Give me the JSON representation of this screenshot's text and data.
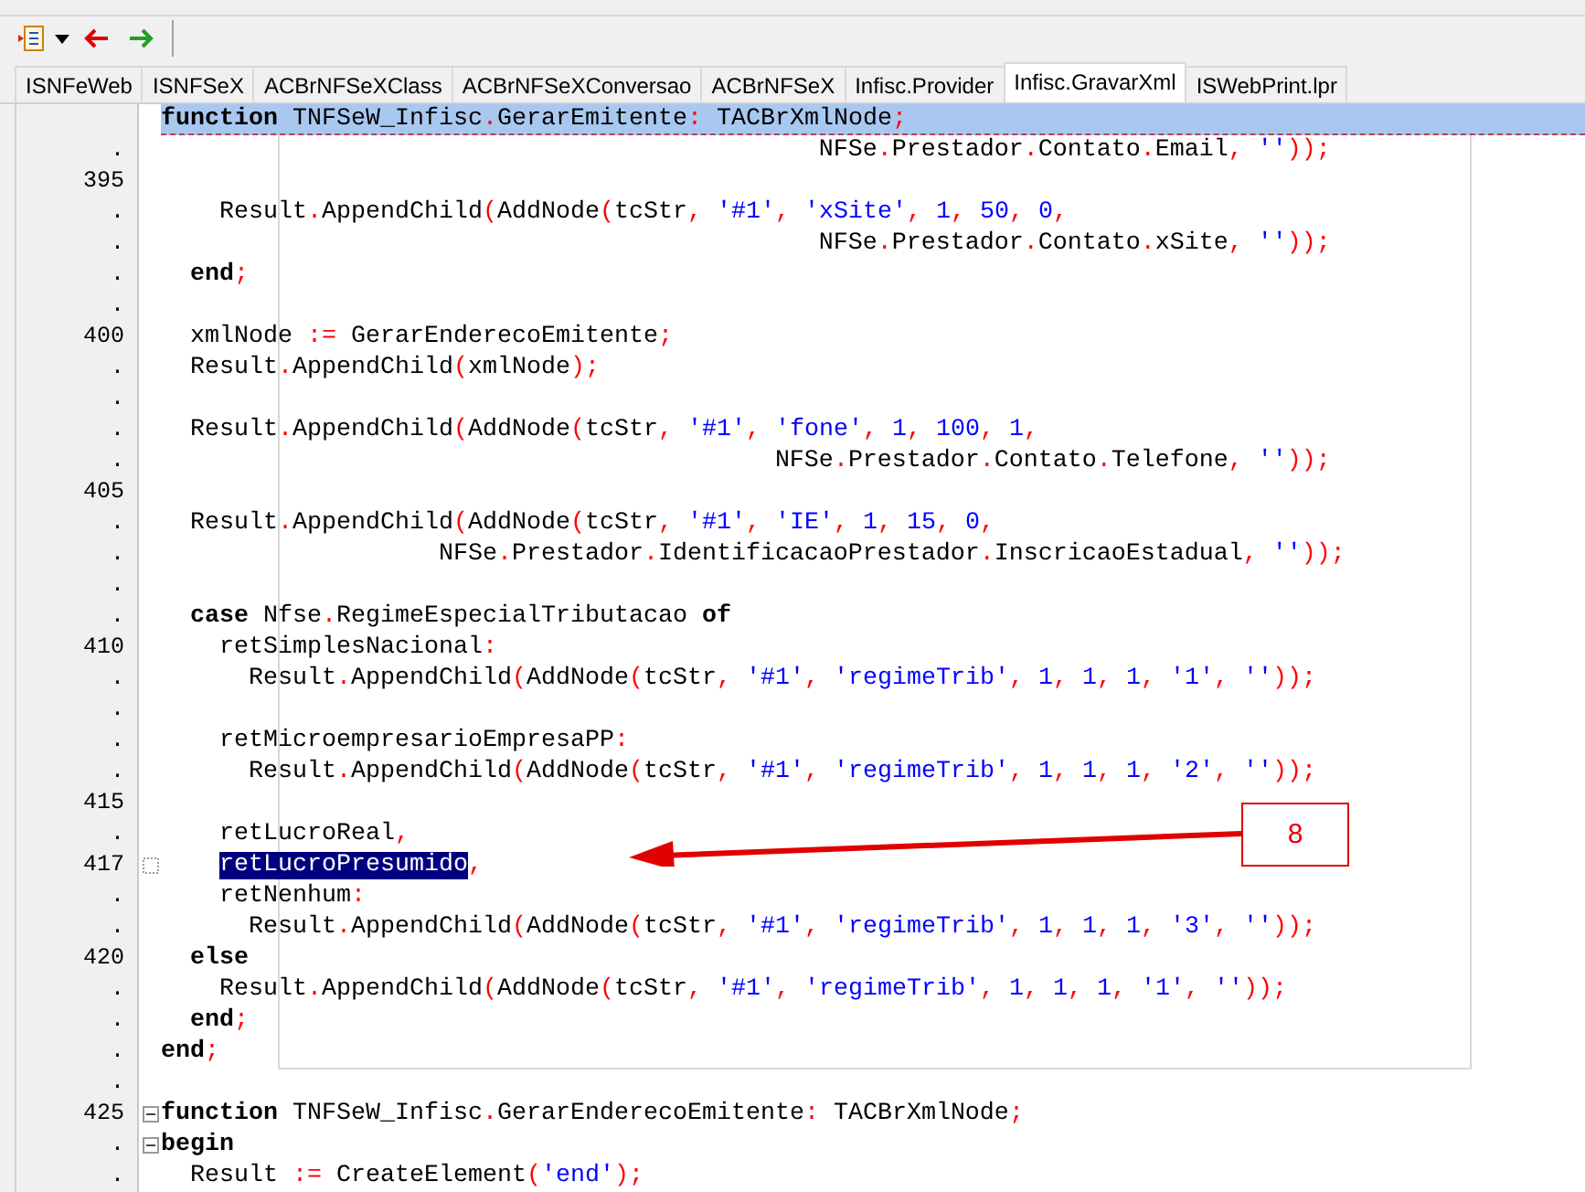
{
  "tabs": [
    {
      "label": "ISNFeWeb",
      "selected": false
    },
    {
      "label": "ISNFSeX",
      "selected": false
    },
    {
      "label": "ACBrNFSeXClass",
      "selected": false
    },
    {
      "label": "ACBrNFSeXConversao",
      "selected": false
    },
    {
      "label": "ACBrNFSeX",
      "selected": false
    },
    {
      "label": "Infisc.Provider",
      "selected": false
    },
    {
      "label": "Infisc.GravarXml",
      "selected": true
    },
    {
      "label": "ISWebPrint.lpr",
      "selected": false
    }
  ],
  "editor": {
    "lines": [
      {
        "current": true,
        "tokens": [
          {
            "kind": "k",
            "text": "function"
          },
          {
            "kind": "t",
            "text": " TNFSeW_Infisc"
          },
          {
            "kind": "s",
            "text": "."
          },
          {
            "kind": "t",
            "text": "GerarEmitente"
          },
          {
            "kind": "s",
            "text": ": "
          },
          {
            "kind": "t",
            "text": "TACBrXmlNode"
          },
          {
            "kind": "s",
            "text": ";"
          }
        ]
      },
      {
        "gutter": ".",
        "tokens": [
          {
            "kind": "t",
            "text": "                                             NFSe"
          },
          {
            "kind": "s",
            "text": "."
          },
          {
            "kind": "t",
            "text": "Prestador"
          },
          {
            "kind": "s",
            "text": "."
          },
          {
            "kind": "t",
            "text": "Contato"
          },
          {
            "kind": "s",
            "text": "."
          },
          {
            "kind": "t",
            "text": "Email"
          },
          {
            "kind": "s",
            "text": ", "
          },
          {
            "kind": "q",
            "text": "''"
          },
          {
            "kind": "s",
            "text": "));"
          }
        ]
      },
      {
        "gutter": "395"
      },
      {
        "gutter": ".",
        "tokens": [
          {
            "kind": "t",
            "text": "    Result"
          },
          {
            "kind": "s",
            "text": "."
          },
          {
            "kind": "t",
            "text": "AppendChild"
          },
          {
            "kind": "s",
            "text": "("
          },
          {
            "kind": "t",
            "text": "AddNode"
          },
          {
            "kind": "s",
            "text": "("
          },
          {
            "kind": "t",
            "text": "tcStr"
          },
          {
            "kind": "s",
            "text": ", "
          },
          {
            "kind": "q",
            "text": "'#1'"
          },
          {
            "kind": "s",
            "text": ", "
          },
          {
            "kind": "q",
            "text": "'xSite'"
          },
          {
            "kind": "s",
            "text": ", "
          },
          {
            "kind": "q",
            "text": "1"
          },
          {
            "kind": "s",
            "text": ", "
          },
          {
            "kind": "q",
            "text": "50"
          },
          {
            "kind": "s",
            "text": ", "
          },
          {
            "kind": "q",
            "text": "0"
          },
          {
            "kind": "s",
            "text": ","
          }
        ]
      },
      {
        "gutter": ".",
        "tokens": [
          {
            "kind": "t",
            "text": "                                             NFSe"
          },
          {
            "kind": "s",
            "text": "."
          },
          {
            "kind": "t",
            "text": "Prestador"
          },
          {
            "kind": "s",
            "text": "."
          },
          {
            "kind": "t",
            "text": "Contato"
          },
          {
            "kind": "s",
            "text": "."
          },
          {
            "kind": "t",
            "text": "xSite"
          },
          {
            "kind": "s",
            "text": ", "
          },
          {
            "kind": "q",
            "text": "''"
          },
          {
            "kind": "s",
            "text": "));"
          }
        ]
      },
      {
        "gutter": ".",
        "tokens": [
          {
            "kind": "k",
            "text": "  end"
          },
          {
            "kind": "s",
            "text": ";"
          }
        ]
      },
      {
        "gutter": "."
      },
      {
        "gutter": "400",
        "tokens": [
          {
            "kind": "t",
            "text": "  xmlNode "
          },
          {
            "kind": "s",
            "text": ":="
          },
          {
            "kind": "t",
            "text": " GerarEnderecoEmitente"
          },
          {
            "kind": "s",
            "text": ";"
          }
        ]
      },
      {
        "gutter": ".",
        "tokens": [
          {
            "kind": "t",
            "text": "  Result"
          },
          {
            "kind": "s",
            "text": "."
          },
          {
            "kind": "t",
            "text": "AppendChild"
          },
          {
            "kind": "s",
            "text": "("
          },
          {
            "kind": "t",
            "text": "xmlNode"
          },
          {
            "kind": "s",
            "text": ");"
          }
        ]
      },
      {
        "gutter": "."
      },
      {
        "gutter": ".",
        "tokens": [
          {
            "kind": "t",
            "text": "  Result"
          },
          {
            "kind": "s",
            "text": "."
          },
          {
            "kind": "t",
            "text": "AppendChild"
          },
          {
            "kind": "s",
            "text": "("
          },
          {
            "kind": "t",
            "text": "AddNode"
          },
          {
            "kind": "s",
            "text": "("
          },
          {
            "kind": "t",
            "text": "tcStr"
          },
          {
            "kind": "s",
            "text": ", "
          },
          {
            "kind": "q",
            "text": "'#1'"
          },
          {
            "kind": "s",
            "text": ", "
          },
          {
            "kind": "q",
            "text": "'fone'"
          },
          {
            "kind": "s",
            "text": ", "
          },
          {
            "kind": "q",
            "text": "1"
          },
          {
            "kind": "s",
            "text": ", "
          },
          {
            "kind": "q",
            "text": "100"
          },
          {
            "kind": "s",
            "text": ", "
          },
          {
            "kind": "q",
            "text": "1"
          },
          {
            "kind": "s",
            "text": ","
          }
        ]
      },
      {
        "gutter": ".",
        "tokens": [
          {
            "kind": "t",
            "text": "                                          NFSe"
          },
          {
            "kind": "s",
            "text": "."
          },
          {
            "kind": "t",
            "text": "Prestador"
          },
          {
            "kind": "s",
            "text": "."
          },
          {
            "kind": "t",
            "text": "Contato"
          },
          {
            "kind": "s",
            "text": "."
          },
          {
            "kind": "t",
            "text": "Telefone"
          },
          {
            "kind": "s",
            "text": ", "
          },
          {
            "kind": "q",
            "text": "''"
          },
          {
            "kind": "s",
            "text": "));"
          }
        ]
      },
      {
        "gutter": "405"
      },
      {
        "gutter": ".",
        "tokens": [
          {
            "kind": "t",
            "text": "  Result"
          },
          {
            "kind": "s",
            "text": "."
          },
          {
            "kind": "t",
            "text": "AppendChild"
          },
          {
            "kind": "s",
            "text": "("
          },
          {
            "kind": "t",
            "text": "AddNode"
          },
          {
            "kind": "s",
            "text": "("
          },
          {
            "kind": "t",
            "text": "tcStr"
          },
          {
            "kind": "s",
            "text": ", "
          },
          {
            "kind": "q",
            "text": "'#1'"
          },
          {
            "kind": "s",
            "text": ", "
          },
          {
            "kind": "q",
            "text": "'IE'"
          },
          {
            "kind": "s",
            "text": ", "
          },
          {
            "kind": "q",
            "text": "1"
          },
          {
            "kind": "s",
            "text": ", "
          },
          {
            "kind": "q",
            "text": "15"
          },
          {
            "kind": "s",
            "text": ", "
          },
          {
            "kind": "q",
            "text": "0"
          },
          {
            "kind": "s",
            "text": ","
          }
        ]
      },
      {
        "gutter": ".",
        "tokens": [
          {
            "kind": "t",
            "text": "                   NFSe"
          },
          {
            "kind": "s",
            "text": "."
          },
          {
            "kind": "t",
            "text": "Prestador"
          },
          {
            "kind": "s",
            "text": "."
          },
          {
            "kind": "t",
            "text": "IdentificacaoPrestador"
          },
          {
            "kind": "s",
            "text": "."
          },
          {
            "kind": "t",
            "text": "InscricaoEstadual"
          },
          {
            "kind": "s",
            "text": ", "
          },
          {
            "kind": "q",
            "text": "''"
          },
          {
            "kind": "s",
            "text": "));"
          }
        ]
      },
      {
        "gutter": "."
      },
      {
        "gutter": ".",
        "tokens": [
          {
            "kind": "k",
            "text": "  case"
          },
          {
            "kind": "t",
            "text": " Nfse"
          },
          {
            "kind": "s",
            "text": "."
          },
          {
            "kind": "t",
            "text": "RegimeEspecialTributacao "
          },
          {
            "kind": "k",
            "text": "of"
          }
        ]
      },
      {
        "gutter": "410",
        "tokens": [
          {
            "kind": "t",
            "text": "    retSimplesNacional"
          },
          {
            "kind": "s",
            "text": ":"
          }
        ]
      },
      {
        "gutter": ".",
        "tokens": [
          {
            "kind": "t",
            "text": "      Result"
          },
          {
            "kind": "s",
            "text": "."
          },
          {
            "kind": "t",
            "text": "AppendChild"
          },
          {
            "kind": "s",
            "text": "("
          },
          {
            "kind": "t",
            "text": "AddNode"
          },
          {
            "kind": "s",
            "text": "("
          },
          {
            "kind": "t",
            "text": "tcStr"
          },
          {
            "kind": "s",
            "text": ", "
          },
          {
            "kind": "q",
            "text": "'#1'"
          },
          {
            "kind": "s",
            "text": ", "
          },
          {
            "kind": "q",
            "text": "'regimeTrib'"
          },
          {
            "kind": "s",
            "text": ", "
          },
          {
            "kind": "q",
            "text": "1"
          },
          {
            "kind": "s",
            "text": ", "
          },
          {
            "kind": "q",
            "text": "1"
          },
          {
            "kind": "s",
            "text": ", "
          },
          {
            "kind": "q",
            "text": "1"
          },
          {
            "kind": "s",
            "text": ", "
          },
          {
            "kind": "q",
            "text": "'1'"
          },
          {
            "kind": "s",
            "text": ", "
          },
          {
            "kind": "q",
            "text": "''"
          },
          {
            "kind": "s",
            "text": "));"
          }
        ]
      },
      {
        "gutter": "."
      },
      {
        "gutter": ".",
        "tokens": [
          {
            "kind": "t",
            "text": "    retMicroempresarioEmpresaPP"
          },
          {
            "kind": "s",
            "text": ":"
          }
        ]
      },
      {
        "gutter": ".",
        "tokens": [
          {
            "kind": "t",
            "text": "      Result"
          },
          {
            "kind": "s",
            "text": "."
          },
          {
            "kind": "t",
            "text": "AppendChild"
          },
          {
            "kind": "s",
            "text": "("
          },
          {
            "kind": "t",
            "text": "AddNode"
          },
          {
            "kind": "s",
            "text": "("
          },
          {
            "kind": "t",
            "text": "tcStr"
          },
          {
            "kind": "s",
            "text": ", "
          },
          {
            "kind": "q",
            "text": "'#1'"
          },
          {
            "kind": "s",
            "text": ", "
          },
          {
            "kind": "q",
            "text": "'regimeTrib'"
          },
          {
            "kind": "s",
            "text": ", "
          },
          {
            "kind": "q",
            "text": "1"
          },
          {
            "kind": "s",
            "text": ", "
          },
          {
            "kind": "q",
            "text": "1"
          },
          {
            "kind": "s",
            "text": ", "
          },
          {
            "kind": "q",
            "text": "1"
          },
          {
            "kind": "s",
            "text": ", "
          },
          {
            "kind": "q",
            "text": "'2'"
          },
          {
            "kind": "s",
            "text": ", "
          },
          {
            "kind": "q",
            "text": "''"
          },
          {
            "kind": "s",
            "text": "));"
          }
        ]
      },
      {
        "gutter": "415"
      },
      {
        "gutter": ".",
        "tokens": [
          {
            "kind": "t",
            "text": "    retLucroReal"
          },
          {
            "kind": "s",
            "text": ","
          }
        ]
      },
      {
        "gutter": "417",
        "fold_marker": {
          "kind": "dotted"
        },
        "tokens": [
          {
            "kind": "sel",
            "text": "    retLucroPresumido"
          },
          {
            "kind": "s",
            "text": ","
          }
        ]
      },
      {
        "gutter": ".",
        "tokens": [
          {
            "kind": "t",
            "text": "    retNenhum"
          },
          {
            "kind": "s",
            "text": ":"
          }
        ]
      },
      {
        "gutter": ".",
        "tokens": [
          {
            "kind": "t",
            "text": "      Result"
          },
          {
            "kind": "s",
            "text": "."
          },
          {
            "kind": "t",
            "text": "AppendChild"
          },
          {
            "kind": "s",
            "text": "("
          },
          {
            "kind": "t",
            "text": "AddNode"
          },
          {
            "kind": "s",
            "text": "("
          },
          {
            "kind": "t",
            "text": "tcStr"
          },
          {
            "kind": "s",
            "text": ", "
          },
          {
            "kind": "q",
            "text": "'#1'"
          },
          {
            "kind": "s",
            "text": ", "
          },
          {
            "kind": "q",
            "text": "'regimeTrib'"
          },
          {
            "kind": "s",
            "text": ", "
          },
          {
            "kind": "q",
            "text": "1"
          },
          {
            "kind": "s",
            "text": ", "
          },
          {
            "kind": "q",
            "text": "1"
          },
          {
            "kind": "s",
            "text": ", "
          },
          {
            "kind": "q",
            "text": "1"
          },
          {
            "kind": "s",
            "text": ", "
          },
          {
            "kind": "q",
            "text": "'3'"
          },
          {
            "kind": "s",
            "text": ", "
          },
          {
            "kind": "q",
            "text": "''"
          },
          {
            "kind": "s",
            "text": "));"
          }
        ]
      },
      {
        "gutter": "420",
        "tokens": [
          {
            "kind": "k",
            "text": "  else"
          }
        ]
      },
      {
        "gutter": ".",
        "tokens": [
          {
            "kind": "t",
            "text": "    Result"
          },
          {
            "kind": "s",
            "text": "."
          },
          {
            "kind": "t",
            "text": "AppendChild"
          },
          {
            "kind": "s",
            "text": "("
          },
          {
            "kind": "t",
            "text": "AddNode"
          },
          {
            "kind": "s",
            "text": "("
          },
          {
            "kind": "t",
            "text": "tcStr"
          },
          {
            "kind": "s",
            "text": ", "
          },
          {
            "kind": "q",
            "text": "'#1'"
          },
          {
            "kind": "s",
            "text": ", "
          },
          {
            "kind": "q",
            "text": "'regimeTrib'"
          },
          {
            "kind": "s",
            "text": ", "
          },
          {
            "kind": "q",
            "text": "1"
          },
          {
            "kind": "s",
            "text": ", "
          },
          {
            "kind": "q",
            "text": "1"
          },
          {
            "kind": "s",
            "text": ", "
          },
          {
            "kind": "q",
            "text": "1"
          },
          {
            "kind": "s",
            "text": ", "
          },
          {
            "kind": "q",
            "text": "'1'"
          },
          {
            "kind": "s",
            "text": ", "
          },
          {
            "kind": "q",
            "text": "''"
          },
          {
            "kind": "s",
            "text": "));"
          }
        ]
      },
      {
        "gutter": ".",
        "tokens": [
          {
            "kind": "k",
            "text": "  end"
          },
          {
            "kind": "s",
            "text": ";"
          }
        ]
      },
      {
        "gutter": ".",
        "tokens": [
          {
            "kind": "k",
            "text": "end"
          },
          {
            "kind": "s",
            "text": ";"
          }
        ]
      },
      {
        "gutter": "."
      },
      {
        "gutter": "425",
        "fold_marker": {
          "kind": "minus"
        },
        "tokens": [
          {
            "kind": "k",
            "text": "function"
          },
          {
            "kind": "t",
            "text": " TNFSeW_Infisc"
          },
          {
            "kind": "s",
            "text": "."
          },
          {
            "kind": "t",
            "text": "GerarEnderecoEmitente"
          },
          {
            "kind": "s",
            "text": ": "
          },
          {
            "kind": "t",
            "text": "TACBrXmlNode"
          },
          {
            "kind": "s",
            "text": ";"
          }
        ]
      },
      {
        "gutter": ".",
        "fold_marker": {
          "kind": "minus"
        },
        "tokens": [
          {
            "kind": "k",
            "text": "begin"
          }
        ]
      },
      {
        "gutter": ".",
        "tokens": [
          {
            "kind": "t",
            "text": "  Result "
          },
          {
            "kind": "s",
            "text": ":="
          },
          {
            "kind": "t",
            "text": " CreateElement"
          },
          {
            "kind": "s",
            "text": "("
          },
          {
            "kind": "q",
            "text": "'end'"
          },
          {
            "kind": "s",
            "text": ");"
          }
        ]
      }
    ]
  },
  "callout": {
    "label": "8"
  }
}
